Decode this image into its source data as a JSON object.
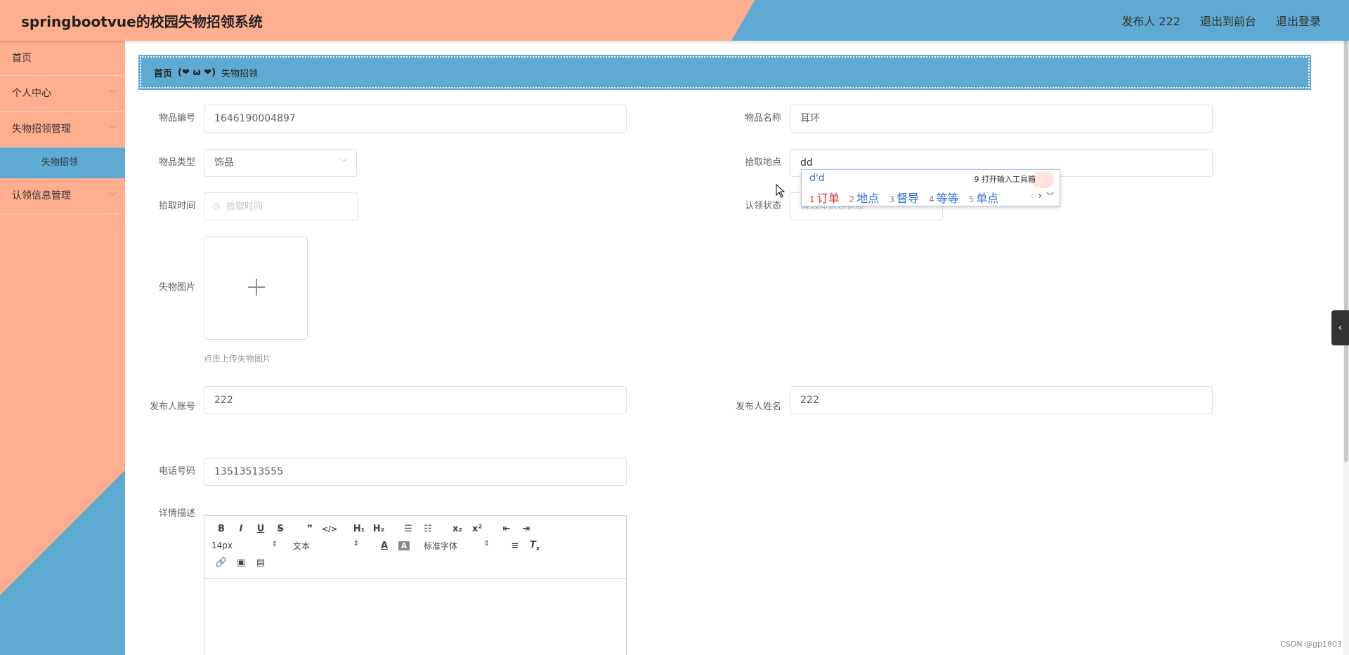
{
  "header": {
    "title": "springbootvue的校园失物招领系统",
    "user": "发布人 222",
    "back_front": "退出到前台",
    "logout": "退出登录"
  },
  "sidebar": {
    "home": "首页",
    "personal": "个人中心",
    "lost_mgmt": "失物招领管理",
    "lost_sub": "失物招领",
    "claim_mgmt": "认领信息管理"
  },
  "breadcrumb": {
    "home": "首页",
    "separator": "(❤ ω ❤)",
    "current": "失物招领"
  },
  "form": {
    "item_no_label": "物品编号",
    "item_no_value": "1646190004897",
    "item_name_label": "物品名称",
    "item_name_value": "耳环",
    "item_type_label": "物品类型",
    "item_type_value": "饰品",
    "pickup_place_label": "拾取地点",
    "pickup_place_value": "dd",
    "pickup_time_label": "拾取时间",
    "pickup_time_placeholder": "拾取时间",
    "claim_status_label": "认领状态",
    "claim_status_placeholder": "请选择认领状态",
    "image_label": "失物图片",
    "image_tip": "点击上传失物图片",
    "publisher_account_label": "发布人账号",
    "publisher_account_value": "222",
    "publisher_name_label": "发布人姓名",
    "publisher_name_value": "222",
    "phone_label": "电话号码",
    "phone_value": "13513513555",
    "detail_label": "详情描述"
  },
  "editor": {
    "font_size": "14px",
    "block_type": "文本",
    "font_family": "标准字体"
  },
  "ime": {
    "composition": "d'd",
    "toolbox": "9 打开输入工具箱",
    "candidates": [
      {
        "num": "1",
        "text": "订单"
      },
      {
        "num": "2",
        "text": "地点"
      },
      {
        "num": "3",
        "text": "督导"
      },
      {
        "num": "4",
        "text": "等等"
      },
      {
        "num": "5",
        "text": "单点"
      }
    ]
  },
  "watermark": "CSDN @gp1803"
}
